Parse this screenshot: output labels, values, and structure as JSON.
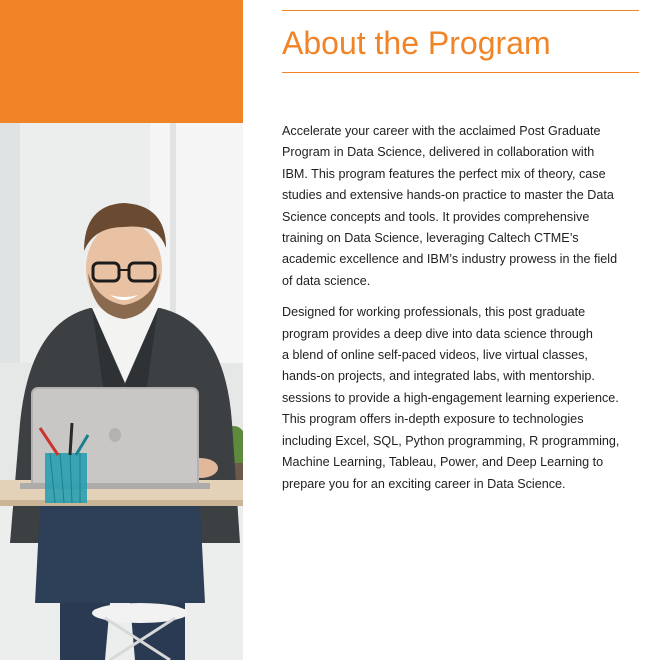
{
  "heading": "About the Program",
  "paragraphs": [
    [
      "Accelerate your career with the acclaimed Post Graduate",
      "Program in Data Science, delivered in collaboration with",
      "IBM. This program features the perfect mix of theory, case",
      "studies and extensive hands-on practice to master the Data",
      "Science concepts and tools. It provides comprehensive",
      "training on Data Science, leveraging Caltech CTME’s",
      "academic excellence and IBM’s industry prowess in the field",
      "of data science."
    ],
    [
      "Designed for working professionals, this post graduate",
      "program provides a deep dive into data science through",
      "a blend of online self-paced videos, live virtual classes,",
      "hands-on projects, and integrated labs, with mentorship.",
      "sessions to provide a high-engagement learning experience.",
      "This program offers in-depth exposure to technologies",
      "including Excel, SQL, Python programming, R programming,",
      "Machine Learning, Tableau, Power, and Deep Learning to",
      "prepare you for an exciting career in Data Science."
    ]
  ],
  "colors": {
    "accent": "#f28428",
    "text": "#1f1f1f"
  }
}
